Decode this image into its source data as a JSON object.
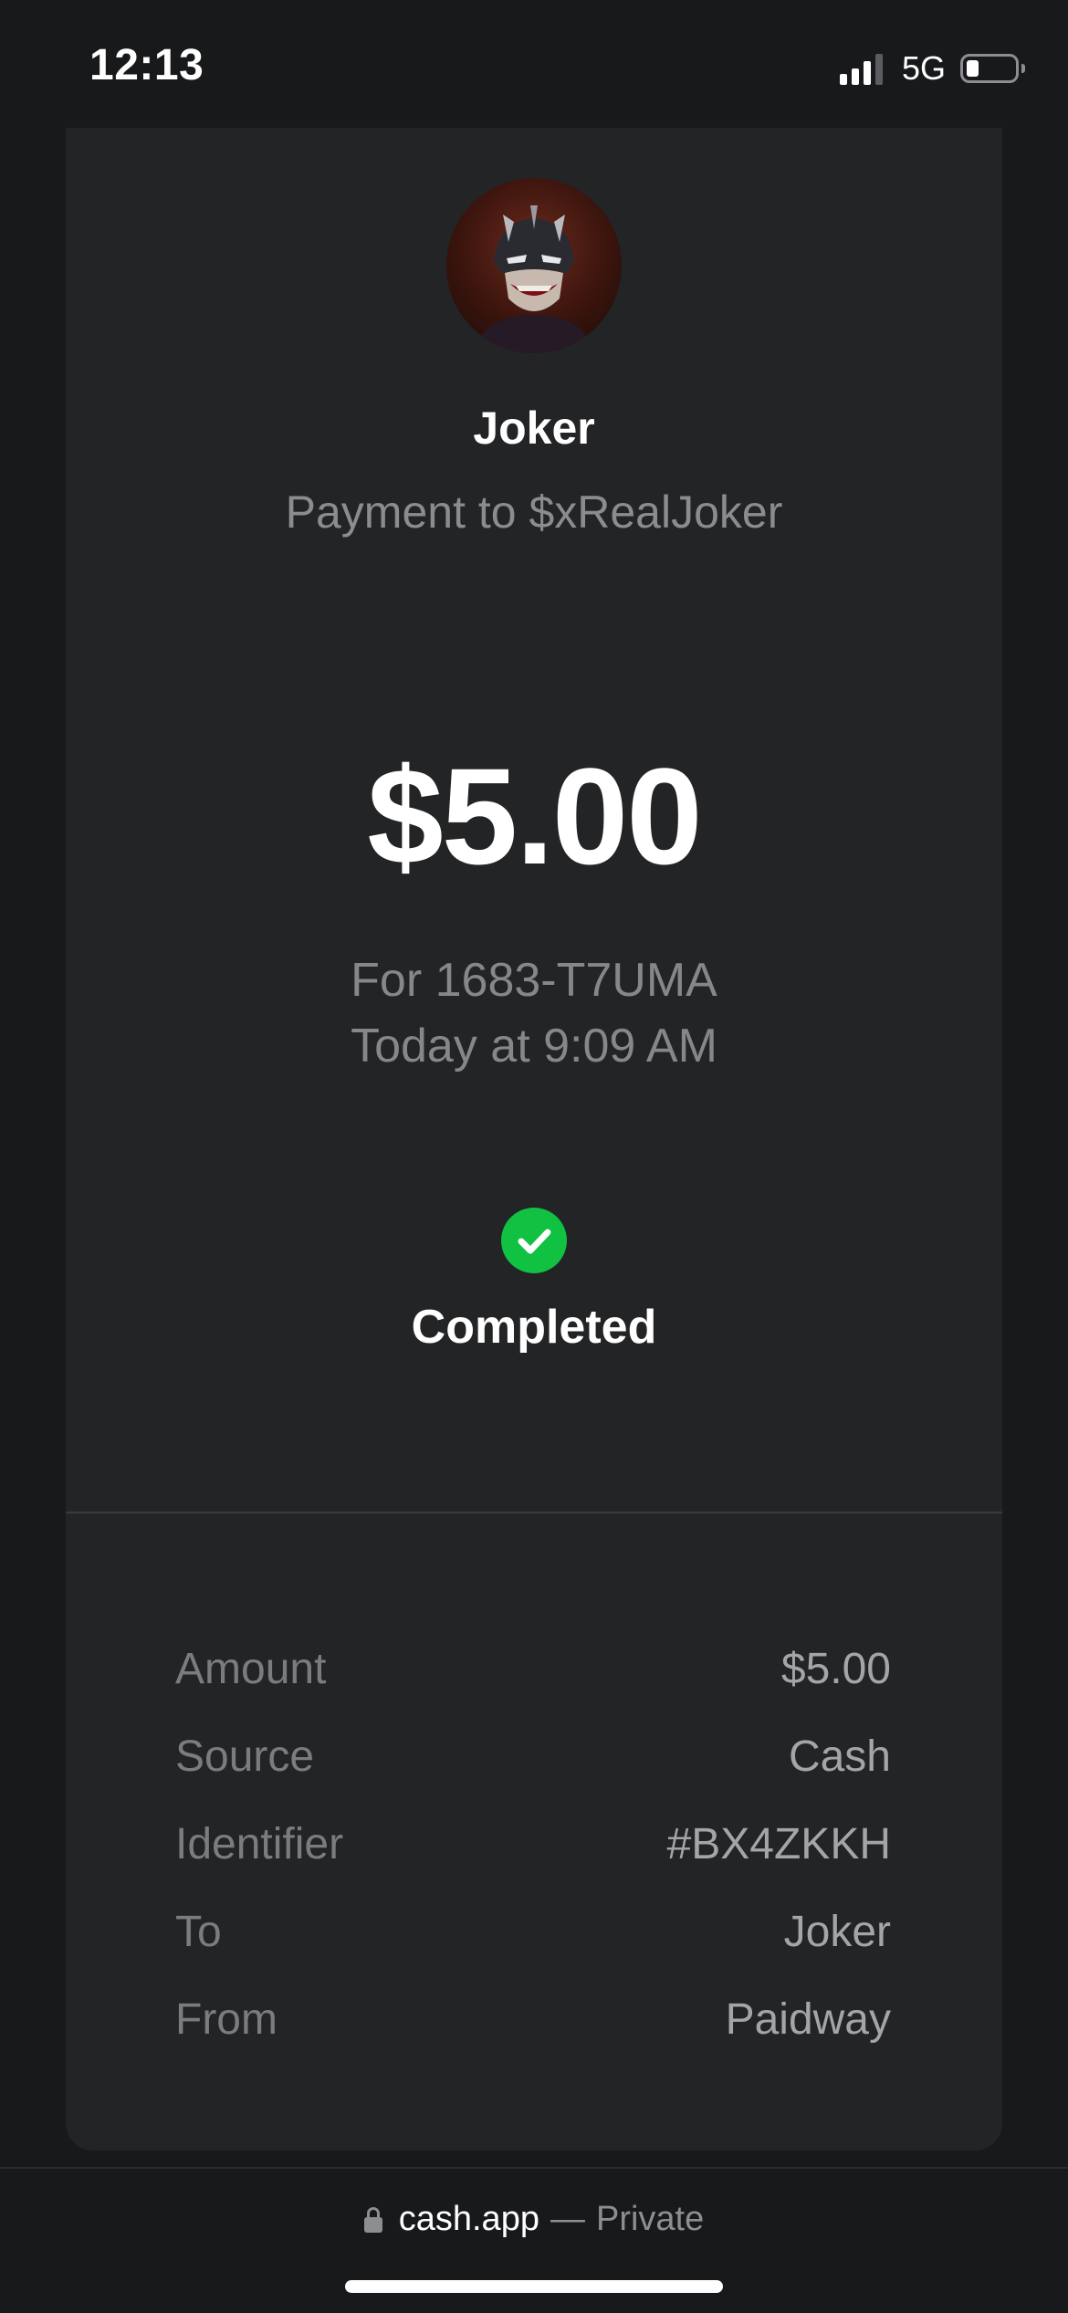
{
  "status_bar": {
    "time": "12:13",
    "network": "5G",
    "signal_bars_active": 3,
    "signal_bars_total": 4,
    "battery_level": 0.25
  },
  "receipt": {
    "avatar_icon": "joker-avatar",
    "payee_name": "Joker",
    "subtitle": "Payment to $xRealJoker",
    "amount": "$5.00",
    "memo": "For 1683-T7UMA",
    "date": "Today at 9:09 AM",
    "status_icon": "check-circle-icon",
    "status": "Completed",
    "status_color": "#10c142",
    "details": [
      {
        "label": "Amount",
        "value": "$5.00"
      },
      {
        "label": "Source",
        "value": "Cash"
      },
      {
        "label": "Identifier",
        "value": "#BX4ZKKH"
      },
      {
        "label": "To",
        "value": "Joker"
      },
      {
        "label": "From",
        "value": "Paidway"
      }
    ]
  },
  "browser": {
    "lock_icon": "lock-icon",
    "domain": "cash.app",
    "separator": "—",
    "privacy": "Private"
  }
}
